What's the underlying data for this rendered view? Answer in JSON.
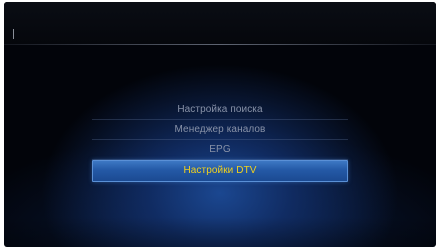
{
  "menu": {
    "items": [
      {
        "label": "Настройка поиска"
      },
      {
        "label": "Менеджер каналов"
      },
      {
        "label": "EPG"
      },
      {
        "label": "Настройки DTV"
      }
    ],
    "selected_index": 3
  },
  "colors": {
    "background": "#02040a",
    "highlight": "#2459a6",
    "selected_text": "#f2d21c",
    "item_text": "#8892a8"
  }
}
